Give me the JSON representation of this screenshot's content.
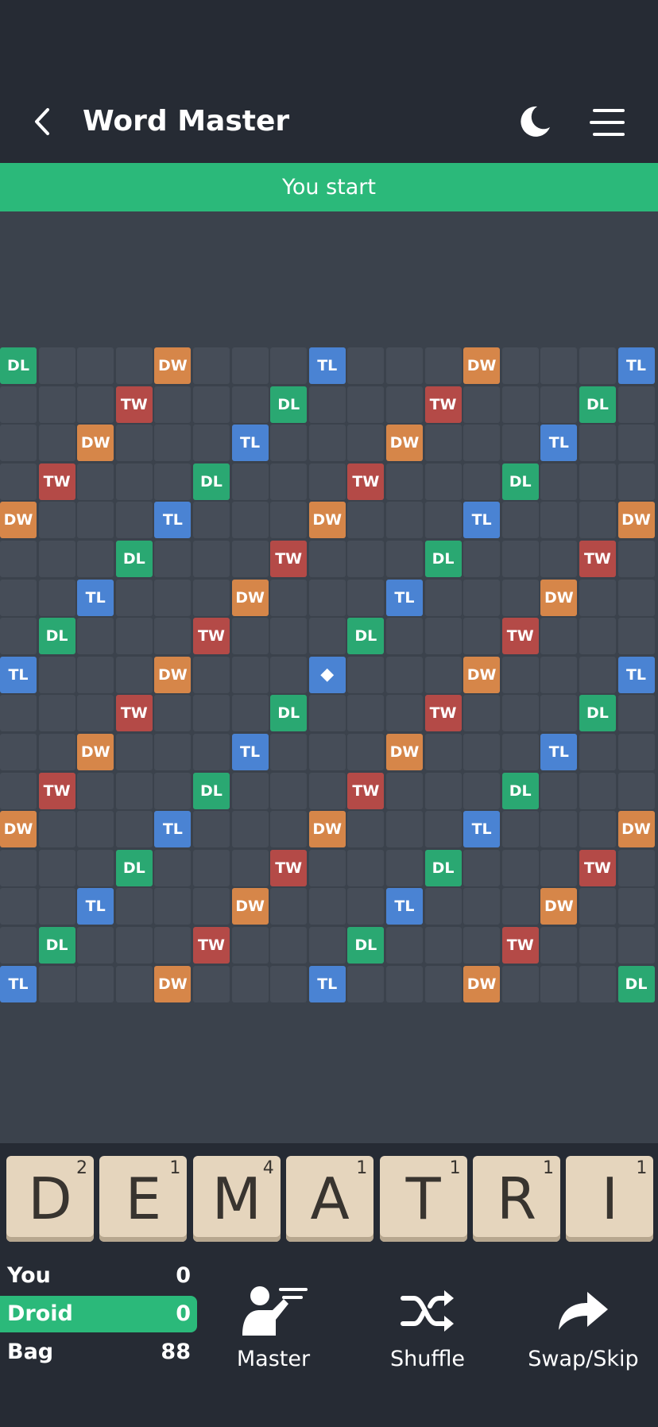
{
  "header": {
    "title": "Word Master",
    "back_icon": "chevron-left-icon",
    "theme_icon": "moon-icon",
    "menu_icon": "hamburger-menu-icon",
    "background": "#262b34"
  },
  "banner": {
    "text": "You start",
    "color": "#2bb97a"
  },
  "board": {
    "size": 17,
    "colors": {
      "DL": "#2aa872",
      "TL": "#4a83d3",
      "DW": "#d68649",
      "TW": "#b44a47",
      "empty": "#464d58"
    },
    "rows": [
      [
        "DL",
        "",
        "",
        "",
        "DW",
        "",
        "",
        "",
        "TL",
        "",
        "",
        "",
        "DW",
        "",
        "",
        "",
        "TL"
      ],
      [
        "",
        "",
        "",
        "TW",
        "",
        "",
        "",
        "DL",
        "",
        "",
        "",
        "TW",
        "",
        "",
        "",
        "DL",
        ""
      ],
      [
        "",
        "",
        "DW",
        "",
        "",
        "",
        "TL",
        "",
        "",
        "",
        "DW",
        "",
        "",
        "",
        "TL",
        "",
        ""
      ],
      [
        "",
        "TW",
        "",
        "",
        "",
        "DL",
        "",
        "",
        "",
        "TW",
        "",
        "",
        "",
        "DL",
        "",
        "",
        ""
      ],
      [
        "DW",
        "",
        "",
        "",
        "TL",
        "",
        "",
        "",
        "DW",
        "",
        "",
        "",
        "TL",
        "",
        "",
        "",
        "DW"
      ],
      [
        "",
        "",
        "",
        "DL",
        "",
        "",
        "",
        "TW",
        "",
        "",
        "",
        "DL",
        "",
        "",
        "",
        "TW",
        ""
      ],
      [
        "",
        "",
        "TL",
        "",
        "",
        "",
        "DW",
        "",
        "",
        "",
        "TL",
        "",
        "",
        "",
        "DW",
        "",
        ""
      ],
      [
        "",
        "DL",
        "",
        "",
        "",
        "TW",
        "",
        "",
        "",
        "DL",
        "",
        "",
        "",
        "TW",
        "",
        "",
        ""
      ],
      [
        "TL",
        "",
        "",
        "",
        "DW",
        "",
        "",
        "",
        "◆",
        "",
        "",
        "",
        "DW",
        "",
        "",
        "",
        "TL"
      ],
      [
        "",
        "",
        "",
        "TW",
        "",
        "",
        "",
        "DL",
        "",
        "",
        "",
        "TW",
        "",
        "",
        "",
        "DL",
        ""
      ],
      [
        "",
        "",
        "DW",
        "",
        "",
        "",
        "TL",
        "",
        "",
        "",
        "DW",
        "",
        "",
        "",
        "TL",
        "",
        ""
      ],
      [
        "",
        "TW",
        "",
        "",
        "",
        "DL",
        "",
        "",
        "",
        "TW",
        "",
        "",
        "",
        "DL",
        "",
        "",
        ""
      ],
      [
        "DW",
        "",
        "",
        "",
        "TL",
        "",
        "",
        "",
        "DW",
        "",
        "",
        "",
        "TL",
        "",
        "",
        "",
        "DW"
      ],
      [
        "",
        "",
        "",
        "DL",
        "",
        "",
        "",
        "TW",
        "",
        "",
        "",
        "DL",
        "",
        "",
        "",
        "TW",
        ""
      ],
      [
        "",
        "",
        "TL",
        "",
        "",
        "",
        "DW",
        "",
        "",
        "",
        "TL",
        "",
        "",
        "",
        "DW",
        "",
        ""
      ],
      [
        "",
        "DL",
        "",
        "",
        "",
        "TW",
        "",
        "",
        "",
        "DL",
        "",
        "",
        "",
        "TW",
        "",
        "",
        ""
      ],
      [
        "TL",
        "",
        "",
        "",
        "DW",
        "",
        "",
        "",
        "TL",
        "",
        "",
        "",
        "DW",
        "",
        "",
        "",
        "DL"
      ]
    ]
  },
  "rack": {
    "tiles": [
      {
        "letter": "D",
        "points": "2"
      },
      {
        "letter": "E",
        "points": "1"
      },
      {
        "letter": "M",
        "points": "4"
      },
      {
        "letter": "A",
        "points": "1"
      },
      {
        "letter": "T",
        "points": "1"
      },
      {
        "letter": "R",
        "points": "1"
      },
      {
        "letter": "I",
        "points": "1"
      }
    ]
  },
  "scores": {
    "you": {
      "label": "You",
      "value": "0"
    },
    "droid": {
      "label": "Droid",
      "value": "0"
    },
    "bag": {
      "label": "Bag",
      "value": "88"
    }
  },
  "actions": {
    "master": {
      "label": "Master",
      "icon": "master-hint-icon"
    },
    "shuffle": {
      "label": "Shuffle",
      "icon": "shuffle-icon"
    },
    "swap": {
      "label": "Swap/Skip",
      "icon": "share-arrow-icon"
    }
  }
}
